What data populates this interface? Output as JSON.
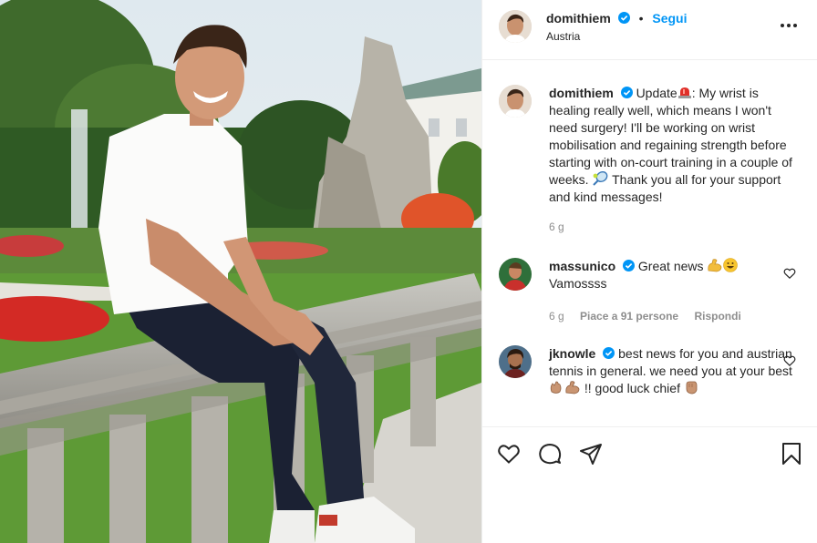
{
  "header": {
    "username": "domithiem",
    "separator": "•",
    "follow_label": "Segui",
    "location": "Austria"
  },
  "caption": {
    "username": "domithiem",
    "text_before_emoji": "Update",
    "text_after_emoji": ": My wrist is healing really well, which means I won't need surgery! I'll be working on wrist mobilisation and regaining strength before starting with on-court training in a couple of weeks. ",
    "text_end": " Thank you all for your support and kind messages!",
    "time": "6 g"
  },
  "comments": [
    {
      "username": "massunico",
      "text": "Great news",
      "text_line2": "Vamossss",
      "time": "6 g",
      "likes": "Piace a 91 persone",
      "reply": "Rispondi"
    },
    {
      "username": "jknowle",
      "text": "best news for you and austrian tennis in general. we need you at your best",
      "text_end": "!! good luck chief"
    }
  ],
  "icons": [
    "verified-badge-icon",
    "more-options-icon",
    "siren-emoji-icon",
    "tennis-emoji-icon",
    "flexed-biceps-emoji-icon",
    "grinning-emoji-icon",
    "clapping-hands-emoji-icon",
    "heart-icon",
    "comment-icon",
    "share-icon",
    "bookmark-icon"
  ],
  "colors": {
    "accent": "#0095f6",
    "text": "#262626",
    "muted": "#8e8e8e",
    "border": "#efefef"
  }
}
